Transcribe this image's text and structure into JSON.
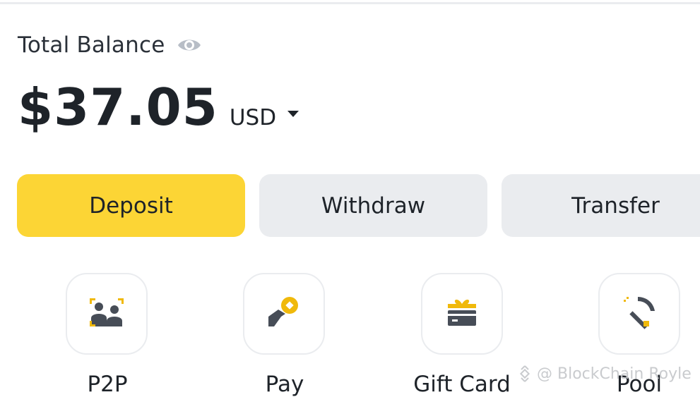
{
  "balance": {
    "label": "Total Balance",
    "amount": "$37.05",
    "currency": "USD",
    "eye_icon": "eye-icon",
    "dropdown_icon": "caret-down-icon"
  },
  "actions": {
    "deposit": "Deposit",
    "withdraw": "Withdraw",
    "transfer": "Transfer"
  },
  "shortcuts": [
    {
      "label": "P2P",
      "icon": "p2p-icon"
    },
    {
      "label": "Pay",
      "icon": "pay-icon"
    },
    {
      "label": "Gift Card",
      "icon": "gift-card-icon"
    },
    {
      "label": "Pool",
      "icon": "pickaxe-icon"
    }
  ],
  "watermark": {
    "text": "@ BlockChain Royle",
    "icon": "binance-logo-icon"
  },
  "colors": {
    "accent": "#fcd535",
    "secondary_button": "#eaecef",
    "text": "#1e2329"
  }
}
